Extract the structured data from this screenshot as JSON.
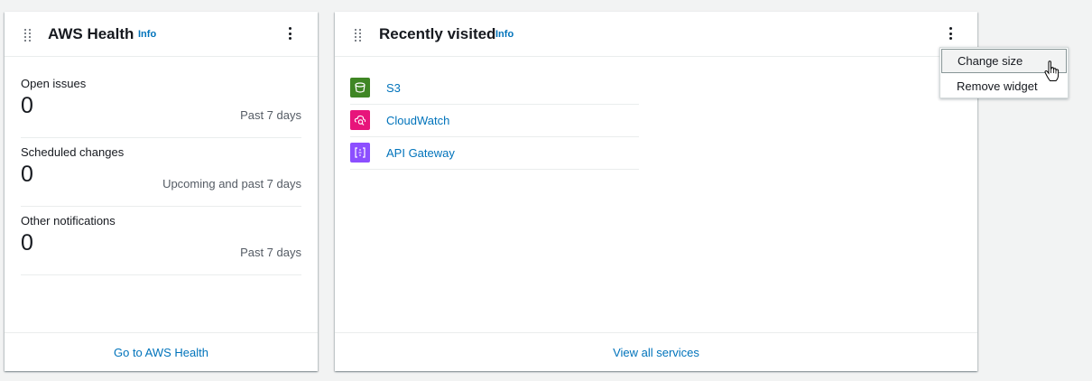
{
  "health_widget": {
    "title": "AWS Health",
    "info": "Info",
    "metrics": [
      {
        "label": "Open issues",
        "value": "0",
        "period": "Past 7 days"
      },
      {
        "label": "Scheduled changes",
        "value": "0",
        "period": "Upcoming and past 7 days"
      },
      {
        "label": "Other notifications",
        "value": "0",
        "period": "Past 7 days"
      }
    ],
    "footer_link": "Go to AWS Health"
  },
  "recent_widget": {
    "title": "Recently visited",
    "info": "Info",
    "services": [
      {
        "name": "S3",
        "icon": "s3-icon",
        "color": "#3f8624"
      },
      {
        "name": "CloudWatch",
        "icon": "cloudwatch-icon",
        "color": "#e7157b"
      },
      {
        "name": "API Gateway",
        "icon": "api-gateway-icon",
        "color": "#8c4fff"
      }
    ],
    "footer_link": "View all services"
  },
  "widget_menu": {
    "items": [
      "Change size",
      "Remove widget"
    ]
  },
  "colors": {
    "link": "#0073bb",
    "background": "#f2f3f3"
  }
}
